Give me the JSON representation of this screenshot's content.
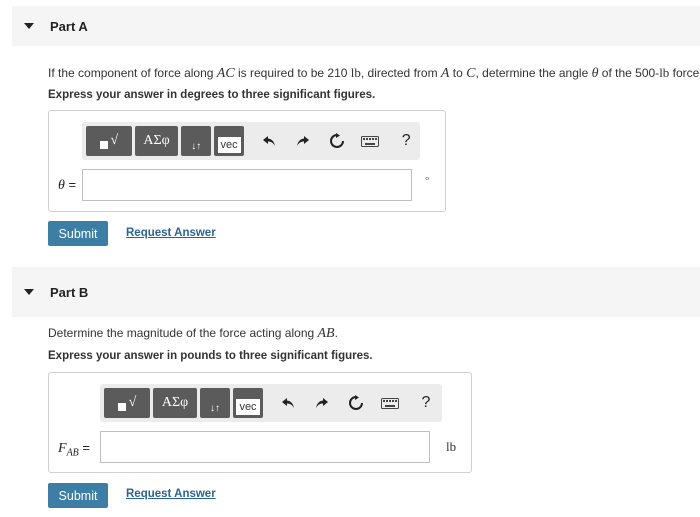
{
  "partA": {
    "title": "Part A",
    "prompt_pre": "If the component of force along ",
    "prompt_ac": "AC",
    "prompt_mid1": " is required to be 210 ",
    "prompt_lb1": "lb",
    "prompt_mid2": ", directed from ",
    "prompt_a": "A",
    "prompt_mid3": " to ",
    "prompt_c": "C",
    "prompt_mid4": ", determine the angle ",
    "prompt_theta": "θ",
    "prompt_mid5": " of the 500-",
    "prompt_lb2": "lb",
    "prompt_end": " force.",
    "instruction": "Express your answer in degrees to three significant figures.",
    "var_symbol": "θ",
    "var_eq": " =",
    "input_value": "",
    "unit": "°",
    "submit_label": "Submit",
    "request_label": "Request Answer"
  },
  "partB": {
    "title": "Part B",
    "prompt_pre": "Determine the magnitude of the force acting along ",
    "prompt_ab": "AB",
    "prompt_end": ".",
    "instruction": "Express your answer in pounds to three significant figures.",
    "var_symbol": "F",
    "var_sub": "AB",
    "var_eq": " =",
    "input_value": "",
    "unit": "lb",
    "submit_label": "Submit",
    "request_label": "Request Answer"
  },
  "toolbar": {
    "templates_label": "√",
    "symbols_label": "ΑΣφ",
    "order_label": "↓↑",
    "vec_label": "vec",
    "help_label": "?"
  },
  "colors": {
    "submit": "#3d7ea6",
    "link": "#2a6495",
    "header_bg": "#f5f5f5",
    "tool_btn": "#5b5b5b"
  }
}
